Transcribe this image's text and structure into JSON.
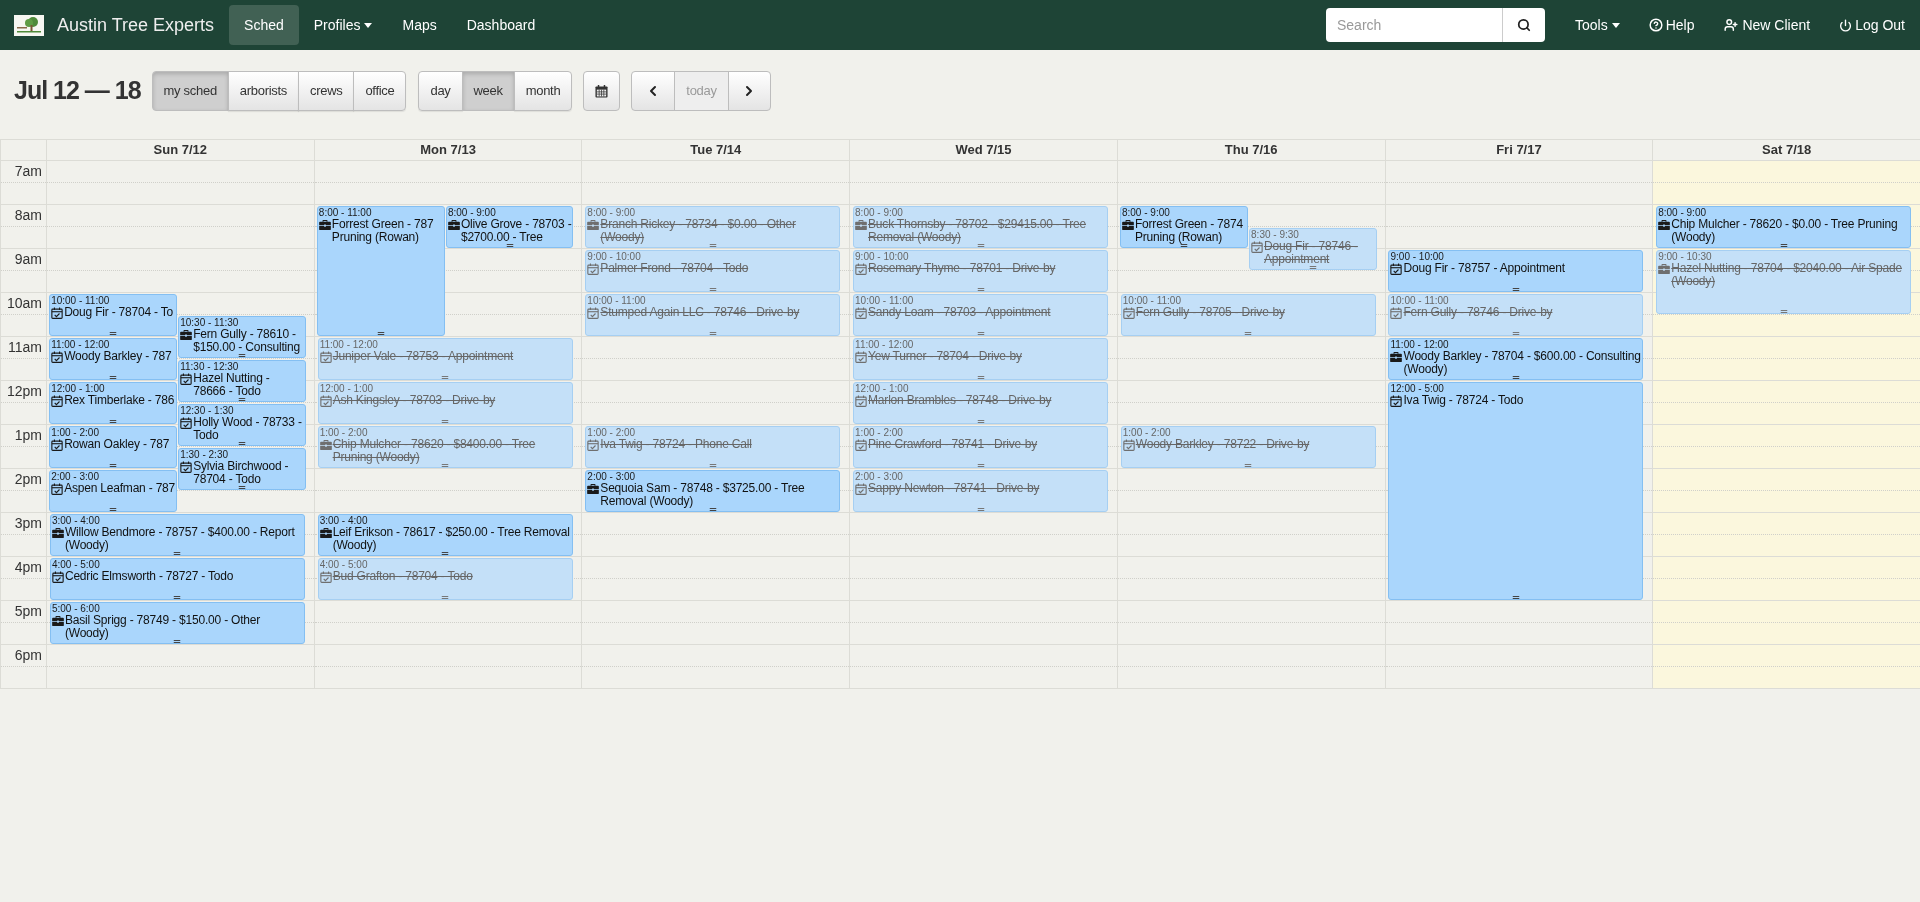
{
  "navbar": {
    "brand": "Austin Tree Experts",
    "nav_items": [
      {
        "label": "Sched",
        "selected": true,
        "dropdown": false
      },
      {
        "label": "Profiles",
        "selected": false,
        "dropdown": true
      },
      {
        "label": "Maps",
        "selected": false,
        "dropdown": false
      },
      {
        "label": "Dashboard",
        "selected": false,
        "dropdown": false
      }
    ],
    "search": {
      "placeholder": "Search"
    },
    "right_items": [
      {
        "label": "Tools",
        "kind": "menu"
      },
      {
        "label": "Help",
        "kind": "help"
      },
      {
        "label": "New Client",
        "kind": "add-user"
      },
      {
        "label": "Log Out",
        "kind": "logout"
      }
    ]
  },
  "toolbar": {
    "title": "Jul 12 — 18",
    "view_filters": [
      {
        "label": "my sched",
        "selected": true
      },
      {
        "label": "arborists",
        "selected": false
      },
      {
        "label": "crews",
        "selected": false
      },
      {
        "label": "office",
        "selected": false
      }
    ],
    "view_modes": [
      {
        "label": "day",
        "selected": false
      },
      {
        "label": "week",
        "selected": true
      },
      {
        "label": "month",
        "selected": false
      }
    ],
    "today_button": {
      "label": "today",
      "disabled": true
    }
  },
  "calendar": {
    "time_slots": [
      "7am",
      "8am",
      "9am",
      "10am",
      "11am",
      "12pm",
      "1pm",
      "2pm",
      "3pm",
      "4pm",
      "5pm",
      "6pm"
    ],
    "days": [
      {
        "label": "Sun 7/12",
        "today": false,
        "events": [
          {
            "time": "10:00 - 11:00",
            "kind": "task",
            "title": "Doug Fir - 78704 - To",
            "done": false
          },
          {
            "time": "10:30 - 11:30",
            "kind": "job",
            "title": "Fern Gully - 78610 - $150.00 - Consulting",
            "done": false
          },
          {
            "time": "11:00 - 12:00",
            "kind": "task",
            "title": "Woody Barkley - 787",
            "done": false
          },
          {
            "time": "11:30 - 12:30",
            "kind": "task",
            "title": "Hazel Nutting - 78666 - Todo",
            "done": false
          },
          {
            "time": "12:00 - 1:00",
            "kind": "task",
            "title": "Rex Timberlake - 786",
            "done": false
          },
          {
            "time": "12:30 - 1:30",
            "kind": "task",
            "title": "Holly Wood - 78733 - Todo",
            "done": false
          },
          {
            "time": "1:00 - 2:00",
            "kind": "task",
            "title": "Rowan Oakley - 787",
            "done": false
          },
          {
            "time": "1:30 - 2:30",
            "kind": "task",
            "title": "Sylvia Birchwood - 78704 - Todo",
            "done": false
          },
          {
            "time": "2:00 - 3:00",
            "kind": "task",
            "title": "Aspen Leafman - 787",
            "done": false
          },
          {
            "time": "3:00 - 4:00",
            "kind": "job",
            "title": "Willow Bendmore - 78757 - $400.00 - Report (Woody)",
            "done": false
          },
          {
            "time": "4:00 - 5:00",
            "kind": "task",
            "title": "Cedric Elmsworth - 78727 - Todo",
            "done": false
          },
          {
            "time": "5:00 - 6:00",
            "kind": "job",
            "title": "Basil Sprigg - 78749 - $150.00 - Other (Woody)",
            "done": false
          }
        ]
      },
      {
        "label": "Mon 7/13",
        "today": false,
        "events": [
          {
            "time": "8:00 - 11:00",
            "kind": "job",
            "title": "Forrest Green - 787\nPruning (Rowan)",
            "done": false
          },
          {
            "time": "8:00 - 9:00",
            "kind": "job",
            "title": "Olive Grove - 78703 - $2700.00 - Tree",
            "done": false
          },
          {
            "time": "11:00 - 12:00",
            "kind": "task",
            "title": "Juniper Vale - 78753 - Appointment",
            "done": true
          },
          {
            "time": "12:00 - 1:00",
            "kind": "task",
            "title": "Ash Kingsley - 78703 - Drive-by",
            "done": true
          },
          {
            "time": "1:00 - 2:00",
            "kind": "job",
            "title": "Chip Mulcher - 78620 - $8400.00 - Tree Pruning (Woody)",
            "done": true
          },
          {
            "time": "3:00 - 4:00",
            "kind": "job",
            "title": "Leif Erikson - 78617 - $250.00 - Tree Removal (Woody)",
            "done": false
          },
          {
            "time": "4:00 - 5:00",
            "kind": "task",
            "title": "Bud Grafton - 78704 - Todo",
            "done": true
          }
        ]
      },
      {
        "label": "Tue 7/14",
        "today": false,
        "events": [
          {
            "time": "8:00 - 9:00",
            "kind": "job",
            "title": "Branch Rickey - 78734 - $0.00 - Other (Woody)",
            "done": true
          },
          {
            "time": "9:00 - 10:00",
            "kind": "task",
            "title": "Palmer Frond - 78704 - Todo",
            "done": true
          },
          {
            "time": "10:00 - 11:00",
            "kind": "task",
            "title": "Stumped Again LLC - 78746 - Drive-by",
            "done": true
          },
          {
            "time": "1:00 - 2:00",
            "kind": "task",
            "title": "Iva Twig - 78724 - Phone Call",
            "done": true
          },
          {
            "time": "2:00 - 3:00",
            "kind": "job",
            "title": "Sequoia Sam - 78748 - $3725.00 - Tree Removal (Woody)",
            "done": false
          }
        ]
      },
      {
        "label": "Wed 7/15",
        "today": false,
        "events": [
          {
            "time": "8:00 - 9:00",
            "kind": "job",
            "title": "Buck Thornsby - 78702 - $29415.00 - Tree Removal (Woody)",
            "done": true
          },
          {
            "time": "9:00 - 10:00",
            "kind": "task",
            "title": "Rosemary Thyme - 78701 - Drive-by",
            "done": true
          },
          {
            "time": "10:00 - 11:00",
            "kind": "task",
            "title": "Sandy Loam - 78703 - Appointment",
            "done": true
          },
          {
            "time": "11:00 - 12:00",
            "kind": "task",
            "title": "Yew Turner - 78704 - Drive-by",
            "done": true
          },
          {
            "time": "12:00 - 1:00",
            "kind": "task",
            "title": "Marlon Brambles - 78748 - Drive-by",
            "done": true
          },
          {
            "time": "1:00 - 2:00",
            "kind": "task",
            "title": "Pine Crawford - 78741 - Drive-by",
            "done": true
          },
          {
            "time": "2:00 - 3:00",
            "kind": "task",
            "title": "Sappy Newton - 78741 - Drive-by",
            "done": true
          }
        ]
      },
      {
        "label": "Thu 7/16",
        "today": false,
        "events": [
          {
            "time": "8:00 - 9:00",
            "kind": "job",
            "title": "Forrest Green - 7874\nPruning (Rowan)",
            "done": false
          },
          {
            "time": "8:30 - 9:30",
            "kind": "task",
            "title": "Doug Fir - 78746 - Appointment",
            "done": true
          },
          {
            "time": "10:00 - 11:00",
            "kind": "task",
            "title": "Fern Gully - 78705 - Drive-by",
            "done": true
          },
          {
            "time": "1:00 - 2:00",
            "kind": "task",
            "title": "Woody Barkley - 78722 - Drive-by",
            "done": true
          }
        ]
      },
      {
        "label": "Fri 7/17",
        "today": false,
        "events": [
          {
            "time": "9:00 - 10:00",
            "kind": "task",
            "title": "Doug Fir - 78757 - Appointment",
            "done": false
          },
          {
            "time": "10:00 - 11:00",
            "kind": "task",
            "title": "Fern Gully - 78746 - Drive-by",
            "done": true
          },
          {
            "time": "11:00 - 12:00",
            "kind": "job",
            "title": "Woody Barkley - 78704 - $600.00 - Consulting (Woody)",
            "done": false
          },
          {
            "time": "12:00 - 5:00",
            "kind": "task",
            "title": "Iva Twig - 78724 - Todo",
            "done": false
          }
        ]
      },
      {
        "label": "Sat 7/18",
        "today": true,
        "events": [
          {
            "time": "8:00 - 9:00",
            "kind": "job",
            "title": "Chip Mulcher - 78620 - $0.00 - Tree Pruning (Woody)",
            "done": false
          },
          {
            "time": "9:00 - 10:30",
            "kind": "job",
            "title": "Hazel Nutting - 78704 - $2040.00 - Air Spade (Woody)",
            "done": true
          }
        ]
      }
    ]
  }
}
